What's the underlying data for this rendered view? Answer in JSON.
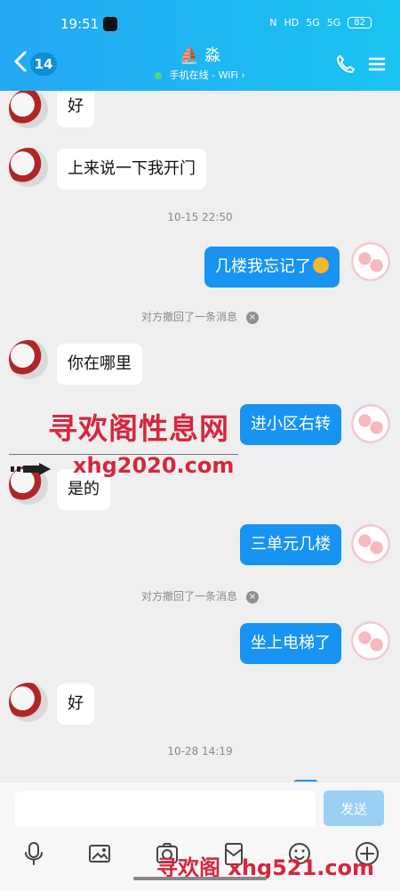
{
  "statusbar": {
    "time": "19:51",
    "nfc": "N",
    "hd": "HD",
    "signal_one": "5G",
    "signal_two": "5G",
    "battery": "82"
  },
  "header": {
    "unread_count": "14",
    "contact_name": "淼",
    "online_status": "手机在线 - WiFi ›",
    "accent": "#1793f2"
  },
  "messages": [
    {
      "type": "left",
      "text": "好"
    },
    {
      "type": "left",
      "text": "上来说一下我开门"
    },
    {
      "type": "time",
      "text": "10-15 22:50"
    },
    {
      "type": "right",
      "text": "几楼我忘记了"
    },
    {
      "type": "notice",
      "text": "对方撤回了一条消息"
    },
    {
      "type": "left",
      "text": "你在哪里"
    },
    {
      "type": "right",
      "text": "进小区右转"
    },
    {
      "type": "left",
      "text": "是的"
    },
    {
      "type": "right",
      "text": "三单元几楼"
    },
    {
      "type": "notice",
      "text": "对方撤回了一条消息"
    },
    {
      "type": "right",
      "text": "坐上电梯了"
    },
    {
      "type": "left",
      "text": "好"
    },
    {
      "type": "time",
      "text": "10-28 14:19"
    }
  ],
  "watermarks": {
    "top_cn": "寻欢阁性息网",
    "top_url": "xhg2020.com",
    "bottom": "寻欢阁 xhg521.com"
  },
  "composer": {
    "input_value": "",
    "send_label": "发送"
  },
  "icons": {
    "toolbar": [
      "microphone-icon",
      "image-icon",
      "camera-icon",
      "red-packet-icon",
      "emoji-icon",
      "plus-icon"
    ]
  }
}
